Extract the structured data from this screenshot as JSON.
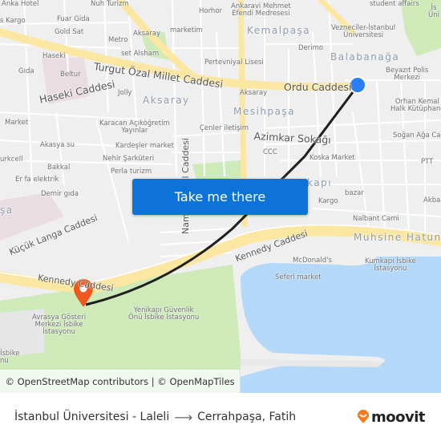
{
  "map": {
    "labels": {
      "anka_hotel": "Anka Hotel",
      "kargo_tl": "s Kargo",
      "nuh_turizm": "Nuh Turizm",
      "fuar_gida": "Fuar Gida",
      "gold_sat": "Gold Sat",
      "metro": "Metro",
      "aksaray_poi": "Aksaray",
      "marketim": "marketim",
      "horhor": "Horhor",
      "set_alsham": "set Alsham",
      "haseki": "Haseki",
      "gida": "Gıda",
      "beltur": "Beltur",
      "jolly": "Jolly",
      "pertevniyal": "Pertevniyal Lisesi",
      "ankaravi": "Ankaravi Mehmet\nEfendi Medresesi",
      "student_affairs": "student affairs",
      "vezneciler": "Vezneciler-İstanbul\nÜniversitesi",
      "derimo": "Derimo",
      "beyazit_polis": "Beyazıt Polis\nMerkezi",
      "aksaray_small": "Aksaray",
      "orhan_kemal": "Orhan Kemal İl\nHalk Kütüphanesi",
      "soganaga": "Soğan Ağa Cami",
      "ptt": "PTT",
      "market_left": "Market",
      "karacan": "Karacan Açıköğretim\nYayınlar",
      "cenler": "Çenler iletişim",
      "akasya": "Akasya su",
      "kardesler": "Kardeşler market",
      "turkcell": "urkcell",
      "nehir": "Nehir Şarküteri",
      "bakkal": "Bakkal",
      "perla": "Perla turizm",
      "erfa": "Er fa elektrik",
      "demir": "Demir gıda",
      "ccc": "CCC",
      "koska": "Koska Market",
      "bazar": "bazar",
      "kargo": "Kargo",
      "akbank": "Akbank",
      "nalbant": "Nalbant Cami",
      "mcdonalds": "McDonald's",
      "seferi": "Seferi market",
      "kumkapi_isbike": "Kumkapı İsbike\nİstasyonu",
      "avrasya": "Avrasya Gösteri\nMerkezi İsbike\nİstasyonu",
      "yenikapi": "Yenikapı Güvenlik\nÖnü İsbike İstasyonu",
      "isbike_left": "İsbike\nnu",
      "istanbul_uni_right": "İs\nÜni"
    },
    "roads": {
      "turgut_ozal": "Turgut Özal Millet Caddesi",
      "haseki_caddesi": "Haseki Caddesi",
      "ordu_caddesi": "Ordu Caddesi",
      "azimkar": "Azimkar Sokağı",
      "namik_kemal": "Namık Kemal Caddesi",
      "kucuk_langa": "Küçük Langa Caddesi",
      "kennedy_1": "Kennedy Caddesi",
      "kennedy_2": "Kennedy Caddesi",
      "muhsine": "Muhsine Hatun"
    },
    "districts": {
      "kemalpasa": "Kemalpaşa",
      "balabanaga": "Balabanağa",
      "aksaray": "Aksaray",
      "mesihpasa": "Mesihpaşa",
      "kumkapi": "Kumkapı",
      "pasa_left": "şa"
    },
    "origin_marker": "origin-dot",
    "destination_marker": "destination-pin",
    "colors": {
      "route": "#1f1f1f",
      "origin": "#2a7df3",
      "destination": "#f0591e",
      "water": "#b3d8f8",
      "park": "#cdeab8",
      "major_road": "#fbe7a1"
    }
  },
  "cta": {
    "label": "Take me there"
  },
  "attribution": "© OpenStreetMap contributors | © OpenMapTiles",
  "footer": {
    "origin": "İstanbul Üniversitesi - Laleli",
    "arrow": "⟶",
    "destination": "Cerrahpaşa, Fatih",
    "brand": "moovit"
  }
}
